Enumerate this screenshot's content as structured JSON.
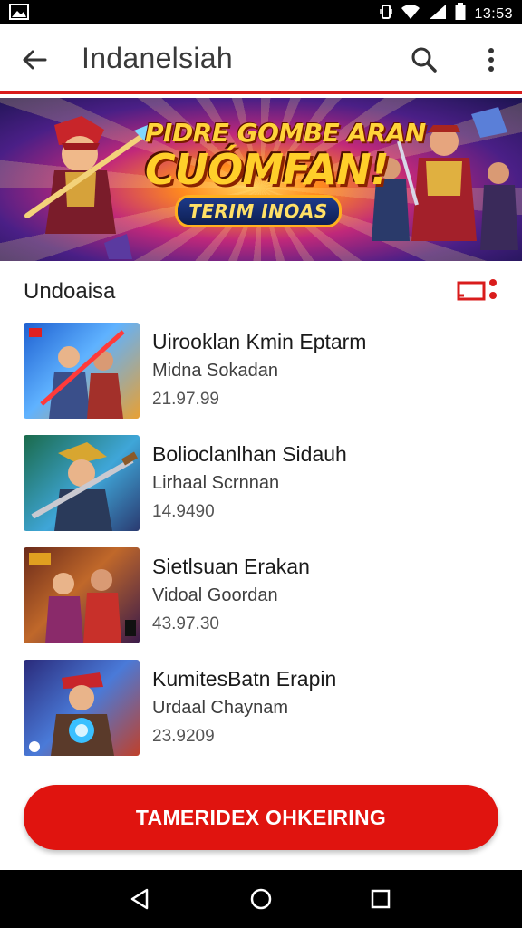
{
  "status_bar": {
    "time": "13:53"
  },
  "app_bar": {
    "title": "Indanelsiah"
  },
  "banner": {
    "line1": "PIDRE GOMBE ARAN",
    "line2": "CUÓMFAN!",
    "pill": "TERIM INOAS"
  },
  "section": {
    "title": "Undoaisa"
  },
  "games": [
    {
      "title": "Uirooklan Kmin Eptarm",
      "subtitle": "Midna Sokadan",
      "price": "21.97.99"
    },
    {
      "title": "Bolioclanlhan Sidauh",
      "subtitle": "Lirhaal Scrnnan",
      "price": "14.9490"
    },
    {
      "title": "Sietlsuan Erakan",
      "subtitle": "Vidoal Goordan",
      "price": "43.97.30"
    },
    {
      "title": "KumitesBatn Erapin",
      "subtitle": "Urdaal Chaynam",
      "price": "23.9209"
    }
  ],
  "cta": {
    "label": "TAMERIDEX OHKEIRING"
  },
  "colors": {
    "accent": "#e0140f",
    "divider": "#d91c1c"
  },
  "icons": [
    "image-icon",
    "vibrate-icon",
    "wifi-icon",
    "signal-icon",
    "battery-icon",
    "back-arrow-icon",
    "search-icon",
    "more-vert-icon",
    "cast-icon",
    "nav-back-icon",
    "nav-home-icon",
    "nav-recents-icon"
  ]
}
